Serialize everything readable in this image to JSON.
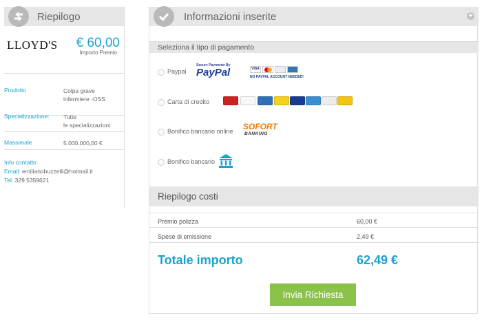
{
  "summary": {
    "title": "Riepilogo",
    "insurer": "LLOYD'S",
    "price": "€ 60,00",
    "price_label": "Importo Premio",
    "rows": [
      {
        "label": "Prodotto",
        "value_line1": "Colpa grave",
        "value_line2": "infermiere -OSS"
      },
      {
        "label": "Specializzazione:",
        "value_line1": "Tutte",
        "value_line2": "le specializzazioni"
      },
      {
        "label": "Massimale",
        "value_line1": "5.000.000,00 €"
      }
    ],
    "contact": {
      "title": "Info contatto",
      "email_label": "Email:",
      "email": "emilianobuzzelli@hotmail.it",
      "tel_label": "Tel:",
      "tel": "329.5359621"
    }
  },
  "info": {
    "title": "Informazioni inserite",
    "payment_header": "Seleziona il tipo di pagamento",
    "options": [
      {
        "label": "Paypal"
      },
      {
        "label": "Carta di credito"
      },
      {
        "label": "Bonifico bancario online"
      },
      {
        "label": "Bonifico bancario"
      }
    ],
    "paypal_secure": "Secure Payments By",
    "paypal_logo": "PayPal",
    "paypal_no_account": "NO PAYPAL ACCOUNT NEEDED!",
    "sofort_top": "SOFORT",
    "sofort_bottom": "BANKING",
    "card_brand_labels": [
      "MasterCard",
      "VISA",
      "",
      "postepay",
      "Maestro",
      "",
      "DISCOVER",
      "Aura"
    ]
  },
  "costs": {
    "title": "Riepilogo costi",
    "rows": [
      {
        "label": "Premio polizza",
        "value": "60,00 €"
      },
      {
        "label": "Spese di emissione",
        "value": "2,49 €"
      }
    ],
    "total_label": "Totale importo",
    "total_value": "62,49 €",
    "submit_label": "Invia Richiesta"
  },
  "colors": {
    "accent": "#1aa3cf",
    "header_bg": "#e6e6e6",
    "submit": "#8bc34a"
  },
  "icons": [
    "swap-arrows-icon",
    "checkmark-icon",
    "plus-icon",
    "bank-icon"
  ]
}
